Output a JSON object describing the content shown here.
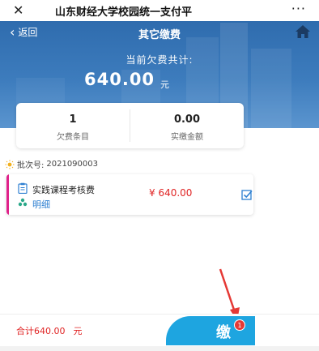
{
  "topbar": {
    "close_icon": "close-icon",
    "title": "山东财经大学校园统一支付平",
    "more_icon": "more-icon"
  },
  "nav": {
    "back_label": "返回",
    "title": "其它缴费",
    "home_icon": "home-icon"
  },
  "owe": {
    "label": "当前欠费共计:",
    "amount": "640.00",
    "unit": "元"
  },
  "summary": {
    "items": [
      {
        "value": "1",
        "label": "欠费条目"
      },
      {
        "value": "0.00",
        "label": "实缴金额"
      }
    ]
  },
  "batch": {
    "label": "批次号:",
    "number": "2021090003"
  },
  "fee_item": {
    "name": "实践课程考核费",
    "detail_label": "明细",
    "price": "¥ 640.00",
    "checked": true,
    "accent_color": "#e0218a"
  },
  "footer": {
    "total_label": "合计640.00",
    "total_unit": "元",
    "pay_label": "缴",
    "badge_count": "1",
    "pay_color": "#1ea5e0"
  }
}
